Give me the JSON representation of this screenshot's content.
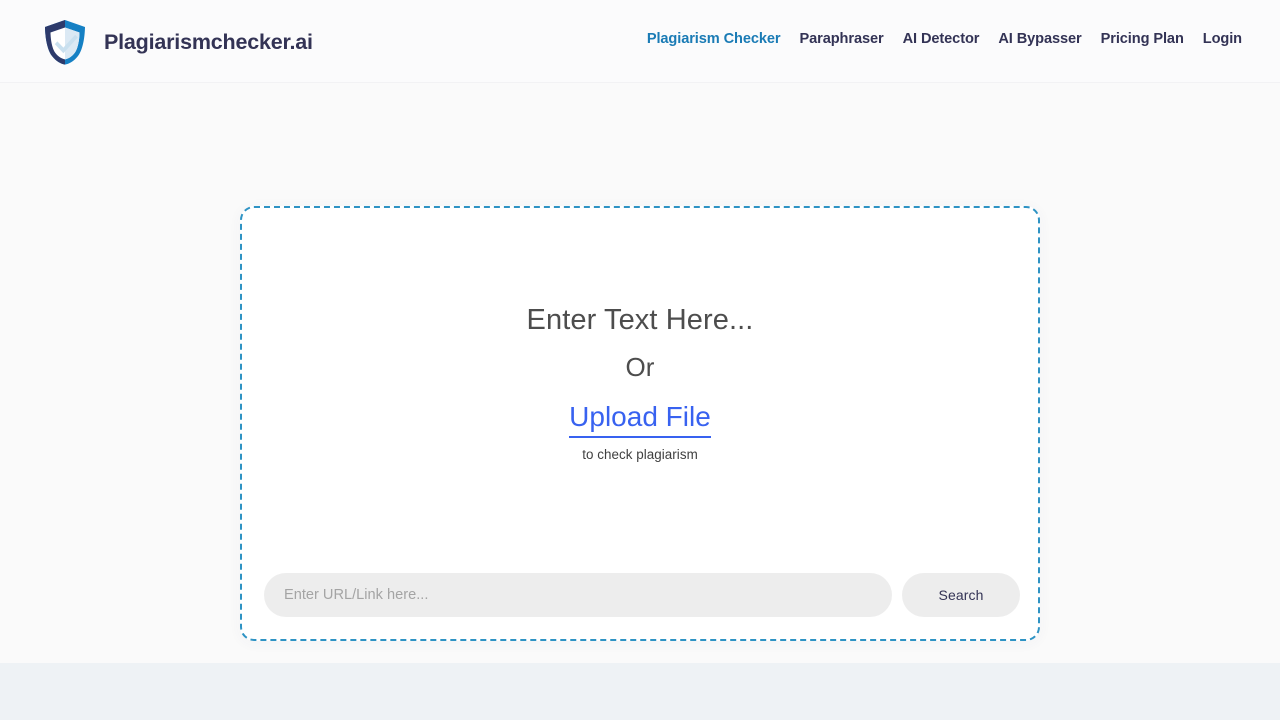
{
  "brand": {
    "name": "Plagiarismchecker.ai",
    "logo_icon": "shield-check-icon",
    "logo_colors": {
      "navy": "#2d3a6b",
      "blue": "#1580c4",
      "check": "#dbe9f4"
    }
  },
  "nav": {
    "items": [
      {
        "label": "Plagiarism Checker",
        "active": true
      },
      {
        "label": "Paraphraser",
        "active": false
      },
      {
        "label": "AI Detector",
        "active": false
      },
      {
        "label": "AI Bypasser",
        "active": false
      },
      {
        "label": "Pricing Plan",
        "active": false
      },
      {
        "label": "Login",
        "active": false
      }
    ],
    "active_color": "#1a7bb5",
    "default_color": "#333355"
  },
  "checker": {
    "prompt_main": "Enter Text Here...",
    "prompt_or": "Or",
    "upload_link": "Upload File",
    "upload_sub": "to check plagiarism",
    "border_color": "#2e93c4",
    "link_color": "#3862f0",
    "url_input": {
      "placeholder": "Enter URL/Link here...",
      "value": ""
    },
    "search_button": "Search"
  },
  "colors": {
    "page_background": "#fafafa",
    "card_background": "#ffffff",
    "lower_band": "#eef2f5",
    "field_background": "#ededed"
  }
}
